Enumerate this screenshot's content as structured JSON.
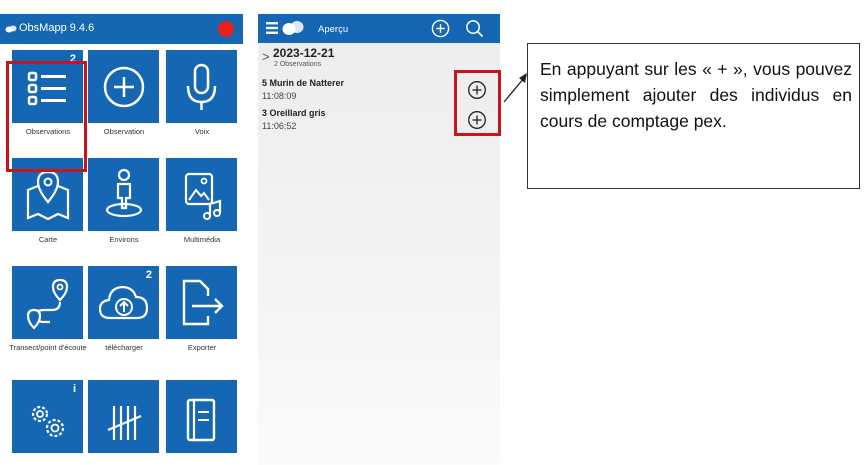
{
  "left_app": {
    "title": "ObsMapp 9.4.6",
    "record_color": "#e5221c",
    "header_color": "#1566b3",
    "tiles": [
      {
        "label": "Observations",
        "icon": "list-icon",
        "badge": "2"
      },
      {
        "label": "Observation",
        "icon": "plus-circle-icon",
        "badge": ""
      },
      {
        "label": "Voix",
        "icon": "microphone-icon",
        "badge": ""
      },
      {
        "label": "Carte",
        "icon": "map-pin-icon",
        "badge": ""
      },
      {
        "label": "Environs",
        "icon": "person-location-icon",
        "badge": ""
      },
      {
        "label": "Multimédia",
        "icon": "media-icon",
        "badge": ""
      },
      {
        "label": "Transect/point d'écoute",
        "icon": "route-icon",
        "badge": ""
      },
      {
        "label": "télécharger",
        "icon": "cloud-upload-icon",
        "badge": "2"
      },
      {
        "label": "Exporter",
        "icon": "export-icon",
        "badge": ""
      },
      {
        "label": "",
        "icon": "settings-icon",
        "badge": "i"
      },
      {
        "label": "",
        "icon": "tally-icon",
        "badge": ""
      },
      {
        "label": "",
        "icon": "book-icon",
        "badge": ""
      }
    ]
  },
  "right_app": {
    "title": "Aperçu",
    "date": "2023-12-21",
    "count": "2 Observations",
    "observations": [
      {
        "name": "5 Murin de Natterer",
        "time": "11:08:09"
      },
      {
        "name": "3 Oreillard gris",
        "time": "11:06:52"
      }
    ]
  },
  "callout": {
    "text": "En appuyant sur les « + », vous pouvez simplement ajouter des individus en cours de comptage pex."
  },
  "highlight_color": "#c4161c"
}
